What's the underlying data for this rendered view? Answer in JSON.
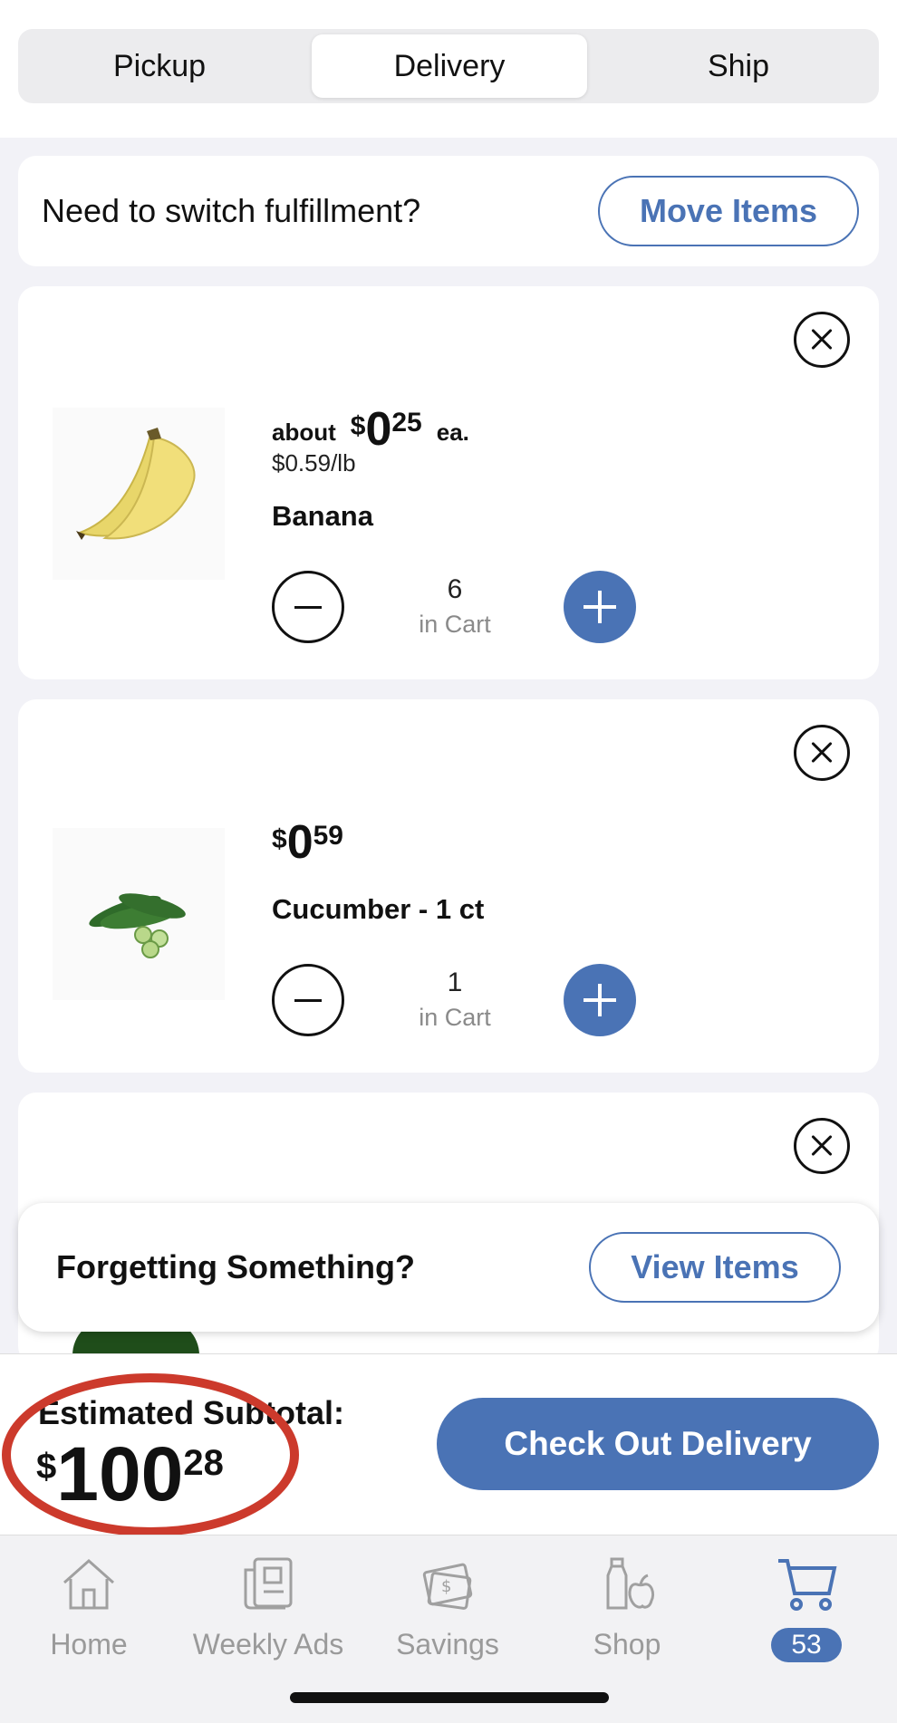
{
  "tabs": [
    {
      "label": "Pickup",
      "active": false
    },
    {
      "label": "Delivery",
      "active": true
    },
    {
      "label": "Ship",
      "active": false
    }
  ],
  "fulfillment": {
    "prompt": "Need to switch fulfillment?",
    "button_label": "Move Items"
  },
  "items": [
    {
      "prefix": "about",
      "currency": "$",
      "dollars": "0",
      "cents": "25",
      "suffix": "ea.",
      "unit_price": "$0.59/lb",
      "name": "Banana",
      "quantity": "6",
      "quantity_label": "in Cart",
      "image_icon": "banana-image"
    },
    {
      "currency": "$",
      "dollars": "0",
      "cents": "59",
      "name": "Cucumber - 1 ct",
      "quantity": "1",
      "quantity_label": "in Cart",
      "image_icon": "cucumber-image"
    },
    {
      "image_icon": "green-pepper-image"
    }
  ],
  "reminder": {
    "text": "Forgetting Something?",
    "button_label": "View Items"
  },
  "summary": {
    "label": "Estimated Subtotal:",
    "currency": "$",
    "dollars": "100",
    "cents": "28",
    "checkout_label": "Check Out Delivery"
  },
  "nav": [
    {
      "label": "Home",
      "icon": "home-icon"
    },
    {
      "label": "Weekly Ads",
      "icon": "weekly-ads-icon"
    },
    {
      "label": "Savings",
      "icon": "savings-icon"
    },
    {
      "label": "Shop",
      "icon": "shop-icon"
    },
    {
      "label": "",
      "icon": "cart-icon",
      "badge": "53",
      "active": true
    }
  ],
  "colors": {
    "accent": "#4a73b5",
    "highlight_ring": "#cc3a2c",
    "background": "#f2f2f7"
  }
}
